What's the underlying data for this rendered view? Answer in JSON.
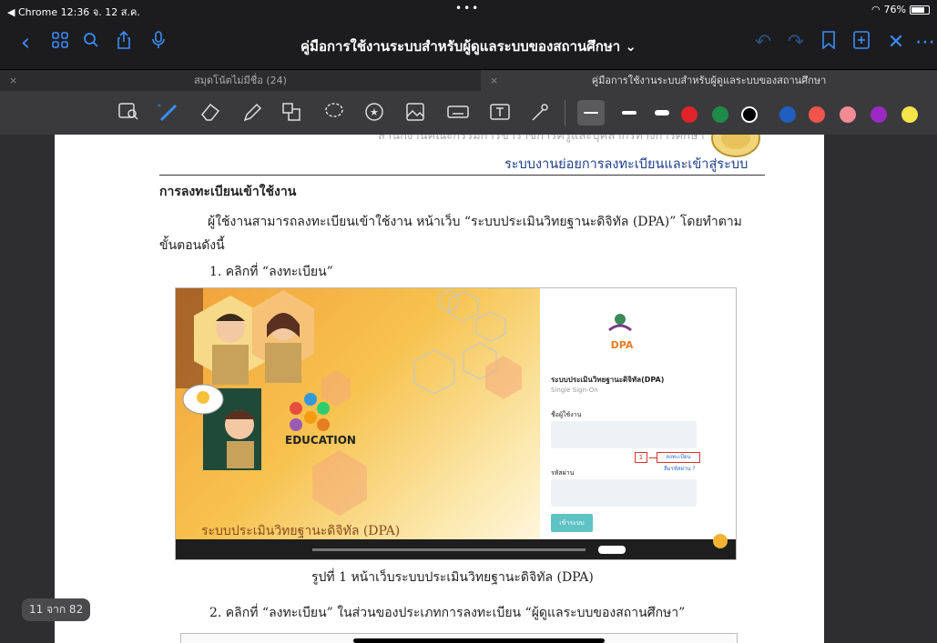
{
  "status": {
    "carrier": "◀ Chrome",
    "time": "12:36",
    "date": "จ. 12 ส.ค.",
    "dots": "•••",
    "wifi": "wifi",
    "battery": "76%"
  },
  "nav": {
    "title": "คู่มือการใช้งานระบบสำหรับผู้ดูแลระบบของสถานศึกษา ⌄"
  },
  "tabs": [
    {
      "label": "สมุดโน้ตไม่มีชื่อ (24)"
    },
    {
      "label": "คู่มือการใช้งานระบบสำหรับผู้ดูแลระบบของสถานศึกษา"
    }
  ],
  "colors": {
    "accent": "#3a8df5",
    "swatches": [
      "#ffffff",
      "#ffffff",
      "#e0242a",
      "#1e8b4b",
      "#000000",
      "#1f5fbf",
      "#f2544d",
      "#f28b94",
      "#9b2ac4",
      "#f5e44a"
    ]
  },
  "document": {
    "header_faded": "สำนักงานคณะกรรมการข้าราชการครูและบุคลากรทางการศึกษา",
    "section_header": "ระบบงานย่อยการลงทะเบียนและเข้าสู่ระบบ",
    "heading": "การลงทะเบียนเข้าใช้งาน",
    "para_line1": "ผู้ใช้งานสามารถลงทะเบียนเข้าใช้งาน หน้าเว็บ “ระบบประเมินวิทยฐานะดิจิทัล (DPA)” โดยทำตาม",
    "para_line2": "ขั้นตอนดังนี้",
    "step1": "1. คลิกที่ “ลงทะเบียน”",
    "caption": "รูปที่ 1 หน้าเว็บระบบประเมินวิทยฐานะดิจิทัล (DPA)",
    "step2": "2. คลิกที่ “ลงทะเบียน” ในส่วนของประเภทการลงทะเบียน “ผู้ดูแลระบบของสถานศึกษา”"
  },
  "figure": {
    "left_title": "ระบบประเมินวิทยฐานะดิจิทัล (DPA)",
    "education": "EDUCATION",
    "logo_text": "DPA",
    "form_title": "ระบบประเมินวิทยฐานะดิจิทัล(DPA)",
    "form_subtitle": "Single Sign-On",
    "username_label": "ชื่อผู้ใช้งาน",
    "password_label": "รหัสผ่าน",
    "register_link": "ลงทะเบียน",
    "forgot_link": "ลืมรหัสผ่าน ?",
    "marker": "1",
    "login_button": "เข้าระบบ"
  },
  "page_indicator": "11 จาก 82"
}
